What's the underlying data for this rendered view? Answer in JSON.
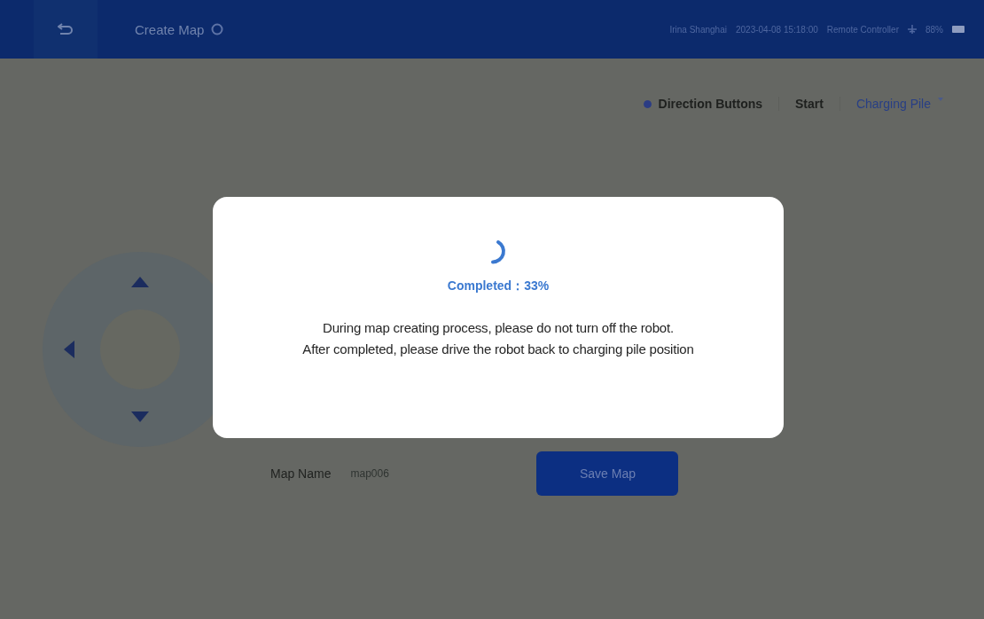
{
  "header": {
    "title": "Create Map",
    "location": "Irina Shanghai",
    "datetime": "2023-04-08 15:18:00",
    "mode": "Remote Controller",
    "battery": "88%"
  },
  "toolbar": {
    "items": [
      {
        "label": "Direction Buttons",
        "kind": "radio",
        "selected": true
      },
      {
        "label": "Start",
        "kind": "plain"
      },
      {
        "label": "Charging Pile",
        "kind": "dropdown"
      }
    ]
  },
  "map_name": {
    "label": "Map Name",
    "value": "map006"
  },
  "save_button": "Save Map",
  "dialog": {
    "progress_text": "Completed：33%",
    "message_lines": [
      "During map creating process, please do not turn off the robot.",
      "After completed, please drive the robot back to charging pile position"
    ]
  }
}
